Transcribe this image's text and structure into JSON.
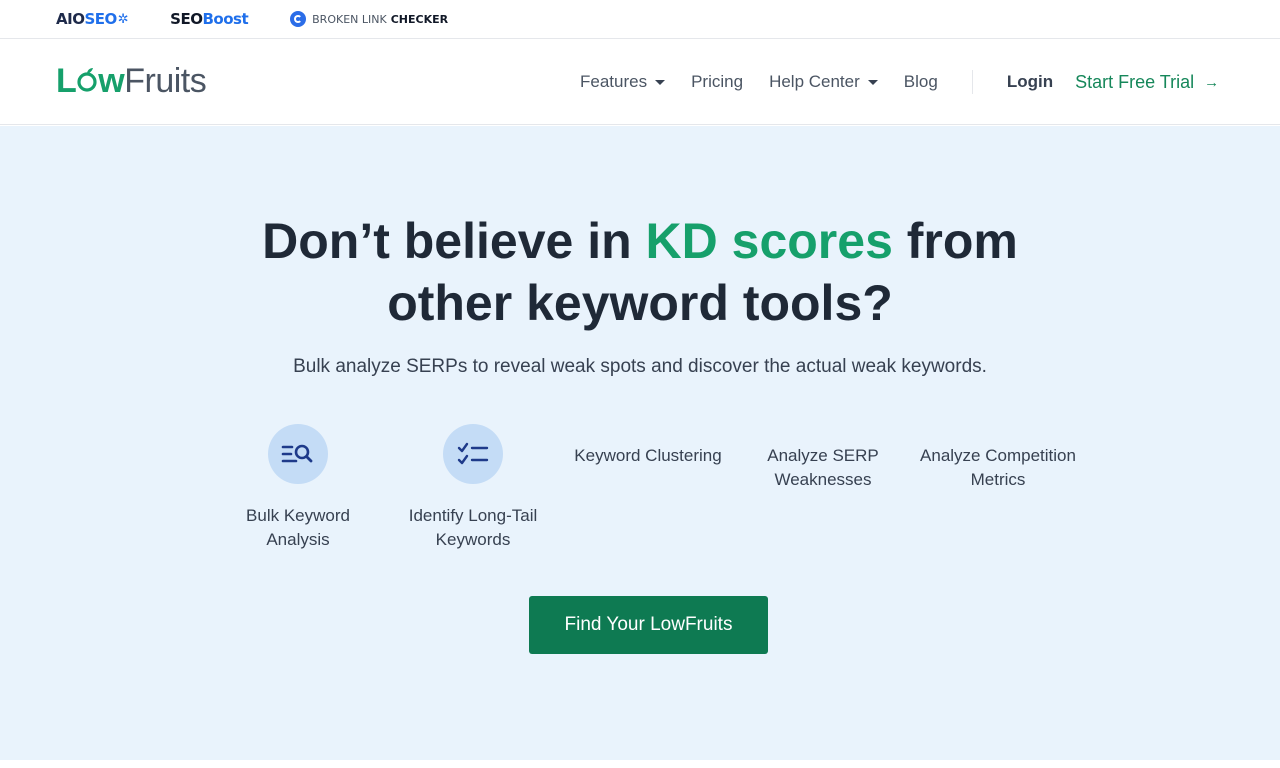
{
  "topbar": {
    "aioseo": {
      "part1": "AIO",
      "part2": "SEO"
    },
    "seoboost": {
      "part1": "SEO",
      "part2": "Boost"
    },
    "blc": {
      "part1": "BROKEN LINK",
      "part2": "CHECKER"
    }
  },
  "logo": {
    "part1": "L",
    "part2": "w",
    "part3": "Fruits"
  },
  "nav": {
    "features": "Features",
    "pricing": "Pricing",
    "help_center": "Help Center",
    "blog": "Blog",
    "login": "Login",
    "trial": "Start Free Trial",
    "trial_arrow": "→"
  },
  "hero": {
    "headline_part1": "Don’t believe in ",
    "headline_green": "KD scores",
    "headline_part2": " from",
    "headline_line2": "other keyword tools?",
    "subtitle": "Bulk analyze SERPs to reveal weak spots and discover the actual weak keywords.",
    "features": [
      {
        "label": "Bulk Keyword Analysis",
        "icon": "search-list-icon"
      },
      {
        "label": "Identify Long-Tail Keywords",
        "icon": "checklist-icon"
      },
      {
        "label": "Keyword Clustering"
      },
      {
        "label": "Analyze SERP Weaknesses"
      },
      {
        "label": "Analyze Competition Metrics"
      }
    ],
    "cta": "Find Your LowFruits"
  },
  "colors": {
    "accent": "#16a06b",
    "cta": "#0e7a52",
    "hero_bg": "#e9f3fc",
    "icon_bg": "#c4dcf6"
  }
}
